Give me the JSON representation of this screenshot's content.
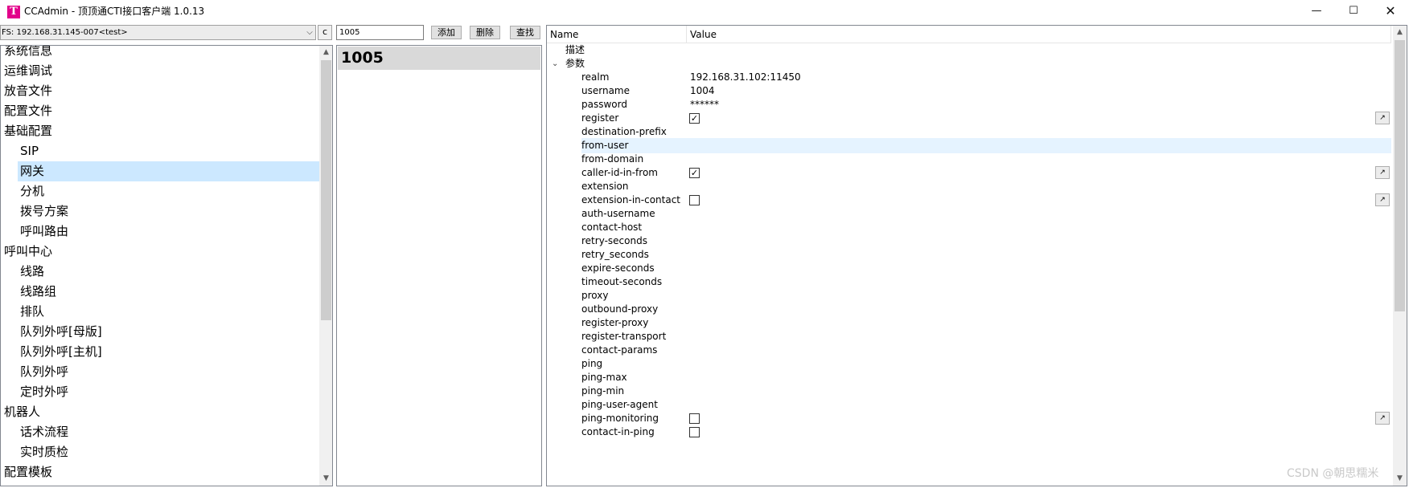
{
  "window": {
    "title": "CCAdmin - 顶顶通CTI接口客户端 1.0.13",
    "app_icon_letter": "T",
    "minimize_glyph": "—",
    "maximize_glyph": "☐",
    "close_glyph": "✕"
  },
  "toolbar": {
    "connection_value": "FS: 192.168.31.145-007<test>",
    "dropdown_glyph": "⌵",
    "refresh_glyph": "c",
    "input_value": "1005",
    "add_label": "添加",
    "delete_label": "删除",
    "find_label": "查找"
  },
  "tree": {
    "items": [
      {
        "label": "系统信息",
        "level": 0
      },
      {
        "label": "运维调试",
        "level": 0
      },
      {
        "label": "放音文件",
        "level": 0
      },
      {
        "label": "配置文件",
        "level": 0
      },
      {
        "label": "基础配置",
        "level": 0
      },
      {
        "label": "SIP",
        "level": 1
      },
      {
        "label": "网关",
        "level": 1,
        "selected": true
      },
      {
        "label": "分机",
        "level": 1
      },
      {
        "label": "拨号方案",
        "level": 1
      },
      {
        "label": "呼叫路由",
        "level": 1
      },
      {
        "label": "呼叫中心",
        "level": 0
      },
      {
        "label": "线路",
        "level": 1
      },
      {
        "label": "线路组",
        "level": 1
      },
      {
        "label": "排队",
        "level": 1
      },
      {
        "label": "队列外呼[母版]",
        "level": 1
      },
      {
        "label": "队列外呼[主机]",
        "level": 1
      },
      {
        "label": "队列外呼",
        "level": 1
      },
      {
        "label": "定时外呼",
        "level": 1
      },
      {
        "label": "机器人",
        "level": 0
      },
      {
        "label": "话术流程",
        "level": 1
      },
      {
        "label": "实时质检",
        "level": 1
      },
      {
        "label": "配置模板",
        "level": 0
      }
    ]
  },
  "middle_list": {
    "items": [
      "1005"
    ]
  },
  "property_grid": {
    "name_header": "Name",
    "value_header": "Value",
    "groups": [
      {
        "label": "描述",
        "expanded": false
      },
      {
        "label": "参数",
        "expanded": true
      }
    ],
    "expander_glyph": "⌄",
    "params": [
      {
        "name": "realm",
        "value": "192.168.31.102:11450"
      },
      {
        "name": "username",
        "value": "1004"
      },
      {
        "name": "password",
        "value": "******"
      },
      {
        "name": "register",
        "checkbox": true,
        "checked": true,
        "edit": true
      },
      {
        "name": "destination-prefix",
        "value": ""
      },
      {
        "name": "from-user",
        "value": "",
        "highlighted": true
      },
      {
        "name": "from-domain",
        "value": ""
      },
      {
        "name": "caller-id-in-from",
        "checkbox": true,
        "checked": true,
        "edit": true
      },
      {
        "name": "extension",
        "value": ""
      },
      {
        "name": "extension-in-contact",
        "checkbox": true,
        "checked": false,
        "edit": true
      },
      {
        "name": "auth-username",
        "value": ""
      },
      {
        "name": "contact-host",
        "value": ""
      },
      {
        "name": "retry-seconds",
        "value": ""
      },
      {
        "name": "retry_seconds",
        "value": ""
      },
      {
        "name": "expire-seconds",
        "value": ""
      },
      {
        "name": "timeout-seconds",
        "value": ""
      },
      {
        "name": "proxy",
        "value": ""
      },
      {
        "name": "outbound-proxy",
        "value": ""
      },
      {
        "name": "register-proxy",
        "value": ""
      },
      {
        "name": "register-transport",
        "value": ""
      },
      {
        "name": "contact-params",
        "value": ""
      },
      {
        "name": "ping",
        "value": ""
      },
      {
        "name": "ping-max",
        "value": ""
      },
      {
        "name": "ping-min",
        "value": ""
      },
      {
        "name": "ping-user-agent",
        "value": ""
      },
      {
        "name": "ping-monitoring",
        "checkbox": true,
        "checked": false,
        "edit": true
      },
      {
        "name": "contact-in-ping",
        "checkbox": true,
        "checked": false
      }
    ],
    "check_glyph": "✓",
    "edit_glyph": "↗"
  },
  "scroll": {
    "up_glyph": "▲",
    "down_glyph": "▼"
  },
  "watermark": "CSDN @朝思糯米"
}
